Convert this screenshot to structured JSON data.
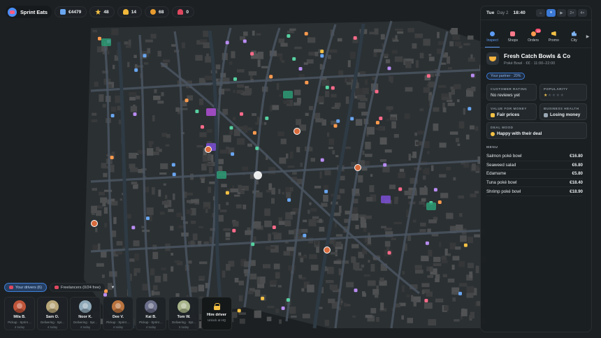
{
  "hud": {
    "brand": "Sprint Eats",
    "money": "€4479",
    "stars": "48",
    "stat3": "14",
    "coins": "68",
    "alerts": "0"
  },
  "clock": {
    "day": "Tue",
    "day_num": "Day 2",
    "time": "18:40",
    "speeds": [
      "⌂",
      "⏸",
      "▶",
      "2×",
      "4×"
    ]
  },
  "tabs": [
    {
      "label": "Inspect",
      "icon": "inspect-icon",
      "color": "#5d9cf5"
    },
    {
      "label": "Shops",
      "icon": "shop-icon",
      "color": "#ff7a8a"
    },
    {
      "label": "Orders",
      "icon": "orders-icon",
      "color": "#ff9b4e",
      "badge": "13"
    },
    {
      "label": "Promo",
      "icon": "promo-icon",
      "color": "#f4c145"
    },
    {
      "label": "City",
      "icon": "city-icon",
      "color": "#7fb6f5"
    }
  ],
  "shop": {
    "name": "Fresh Catch Bowls & Co",
    "subtitle": "Poké Bowl · €€ · 11:00–22:00",
    "partner": "Your partner · 20%",
    "rating_label": "CUSTOMER RATING",
    "rating_value": "No reviews yet",
    "popularity_label": "POPULARITY",
    "popularity_stars": 1,
    "value_label": "VALUE FOR MONEY",
    "value_value": "Fair prices",
    "health_label": "BUSINESS HEALTH",
    "health_value": "Losing money",
    "mood_label": "DEAL MOOD",
    "mood_value": "Happy with their deal",
    "menu_title": "MENU",
    "menu": [
      {
        "item": "Salmon poké bowl",
        "price": "€16.80"
      },
      {
        "item": "Seaweed salad",
        "price": "€6.80"
      },
      {
        "item": "Edamame",
        "price": "€5.80"
      },
      {
        "item": "Tuna poké bowl",
        "price": "€18.40"
      },
      {
        "item": "Shrimp poké bowl",
        "price": "€18.90"
      }
    ]
  },
  "driver_tabs": {
    "yours": "Your drivers (6)",
    "freelancers": "Freelancers (0/24 free)"
  },
  "drivers": [
    {
      "name": "Mila B.",
      "status": "Pickup · Sprint ...",
      "today": "4 today",
      "color": "#c0553a"
    },
    {
      "name": "Sam O.",
      "status": "Delivering · Spr...",
      "today": "4 today",
      "color": "#b9a77a"
    },
    {
      "name": "Noor K.",
      "status": "Delivering · Spr...",
      "today": "4 today",
      "color": "#8fa9b8"
    },
    {
      "name": "Dee V.",
      "status": "Pickup · Sprint ...",
      "today": "4 today",
      "color": "#b9733f"
    },
    {
      "name": "Kai B.",
      "status": "Pickup · Sprint ...",
      "today": "4 today",
      "color": "#6b6f8a"
    },
    {
      "name": "Tom W.",
      "status": "Delivering · Spr...",
      "today": "3 today",
      "color": "#a8b48a"
    }
  ],
  "hire": {
    "title": "Hire driver",
    "subtitle": "Unlock at HQ"
  }
}
